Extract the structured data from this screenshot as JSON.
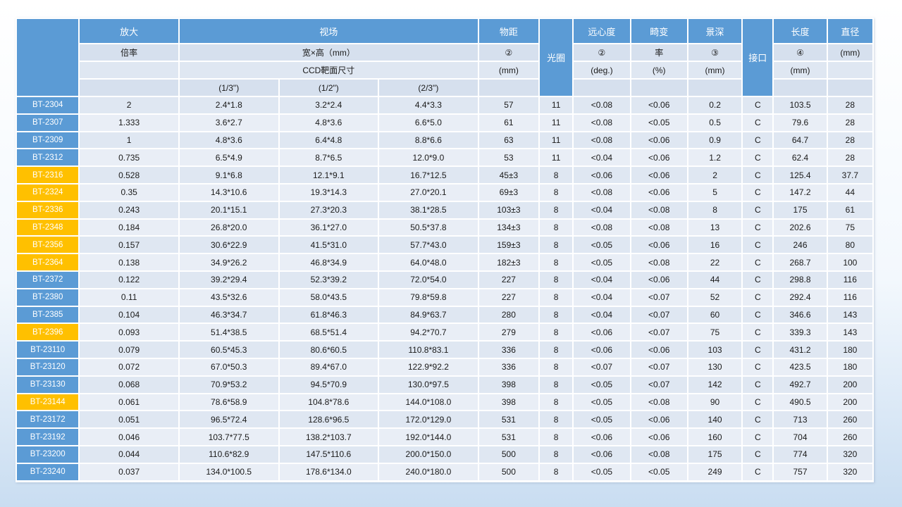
{
  "header": {
    "magnification": "放大",
    "ratio": "倍率",
    "field_of_view": "视场",
    "fov_units": "宽×高（mm）",
    "ccd_target": "CCD靶面尺寸",
    "sensor_1_3": "(1/3\")",
    "sensor_1_2": "(1/2\")",
    "sensor_2_3": "(2/3\")",
    "working_distance": "物距",
    "wd_note": "②",
    "wd_unit": "(mm)",
    "aperture": "光圈",
    "telecentricity": "远心度",
    "tel_note": "②",
    "tel_unit": "(deg.)",
    "distortion": "畸变",
    "distortion_rate": "率",
    "dist_unit": "(%)",
    "dof": "景深",
    "dof_note": "③",
    "dof_unit": "(mm)",
    "mount": "接口",
    "length": "长度",
    "len_note": "④",
    "len_unit": "(mm)",
    "diameter": "直径",
    "dia_unit": "(mm)"
  },
  "rows": [
    {
      "model": "BT-2304",
      "highlight": false,
      "mag": "2",
      "f13": "2.4*1.8",
      "f12": "3.2*2.4",
      "f23": "4.4*3.3",
      "wd": "57",
      "ap": "11",
      "tel": "<0.08",
      "dist": "<0.06",
      "dof": "0.2",
      "mount": "C",
      "len": "103.5",
      "dia": "28"
    },
    {
      "model": "BT-2307",
      "highlight": false,
      "mag": "1.333",
      "f13": "3.6*2.7",
      "f12": "4.8*3.6",
      "f23": "6.6*5.0",
      "wd": "61",
      "ap": "11",
      "tel": "<0.08",
      "dist": "<0.05",
      "dof": "0.5",
      "mount": "C",
      "len": "79.6",
      "dia": "28"
    },
    {
      "model": "BT-2309",
      "highlight": false,
      "mag": "1",
      "f13": "4.8*3.6",
      "f12": "6.4*4.8",
      "f23": "8.8*6.6",
      "wd": "63",
      "ap": "11",
      "tel": "<0.08",
      "dist": "<0.06",
      "dof": "0.9",
      "mount": "C",
      "len": "64.7",
      "dia": "28"
    },
    {
      "model": "BT-2312",
      "highlight": false,
      "mag": "0.735",
      "f13": "6.5*4.9",
      "f12": "8.7*6.5",
      "f23": "12.0*9.0",
      "wd": "53",
      "ap": "11",
      "tel": "<0.04",
      "dist": "<0.06",
      "dof": "1.2",
      "mount": "C",
      "len": "62.4",
      "dia": "28"
    },
    {
      "model": "BT-2316",
      "highlight": true,
      "mag": "0.528",
      "f13": "9.1*6.8",
      "f12": "12.1*9.1",
      "f23": "16.7*12.5",
      "wd": "45±3",
      "ap": "8",
      "tel": "<0.06",
      "dist": "<0.06",
      "dof": "2",
      "mount": "C",
      "len": "125.4",
      "dia": "37.7"
    },
    {
      "model": "BT-2324",
      "highlight": true,
      "mag": "0.35",
      "f13": "14.3*10.6",
      "f12": "19.3*14.3",
      "f23": "27.0*20.1",
      "wd": "69±3",
      "ap": "8",
      "tel": "<0.08",
      "dist": "<0.06",
      "dof": "5",
      "mount": "C",
      "len": "147.2",
      "dia": "44"
    },
    {
      "model": "BT-2336",
      "highlight": true,
      "mag": "0.243",
      "f13": "20.1*15.1",
      "f12": "27.3*20.3",
      "f23": "38.1*28.5",
      "wd": "103±3",
      "ap": "8",
      "tel": "<0.04",
      "dist": "<0.08",
      "dof": "8",
      "mount": "C",
      "len": "175",
      "dia": "61"
    },
    {
      "model": "BT-2348",
      "highlight": true,
      "mag": "0.184",
      "f13": "26.8*20.0",
      "f12": "36.1*27.0",
      "f23": "50.5*37.8",
      "wd": "134±3",
      "ap": "8",
      "tel": "<0.08",
      "dist": "<0.08",
      "dof": "13",
      "mount": "C",
      "len": "202.6",
      "dia": "75"
    },
    {
      "model": "BT-2356",
      "highlight": true,
      "mag": "0.157",
      "f13": "30.6*22.9",
      "f12": "41.5*31.0",
      "f23": "57.7*43.0",
      "wd": "159±3",
      "ap": "8",
      "tel": "<0.05",
      "dist": "<0.06",
      "dof": "16",
      "mount": "C",
      "len": "246",
      "dia": "80"
    },
    {
      "model": "BT-2364",
      "highlight": true,
      "mag": "0.138",
      "f13": "34.9*26.2",
      "f12": "46.8*34.9",
      "f23": "64.0*48.0",
      "wd": "182±3",
      "ap": "8",
      "tel": "<0.05",
      "dist": "<0.08",
      "dof": "22",
      "mount": "C",
      "len": "268.7",
      "dia": "100"
    },
    {
      "model": "BT-2372",
      "highlight": false,
      "mag": "0.122",
      "f13": "39.2*29.4",
      "f12": "52.3*39.2",
      "f23": "72.0*54.0",
      "wd": "227",
      "ap": "8",
      "tel": "<0.04",
      "dist": "<0.06",
      "dof": "44",
      "mount": "C",
      "len": "298.8",
      "dia": "116"
    },
    {
      "model": "BT-2380",
      "highlight": false,
      "mag": "0.11",
      "f13": "43.5*32.6",
      "f12": "58.0*43.5",
      "f23": "79.8*59.8",
      "wd": "227",
      "ap": "8",
      "tel": "<0.04",
      "dist": "<0.07",
      "dof": "52",
      "mount": "C",
      "len": "292.4",
      "dia": "116"
    },
    {
      "model": "BT-2385",
      "highlight": false,
      "mag": "0.104",
      "f13": "46.3*34.7",
      "f12": "61.8*46.3",
      "f23": "84.9*63.7",
      "wd": "280",
      "ap": "8",
      "tel": "<0.04",
      "dist": "<0.07",
      "dof": "60",
      "mount": "C",
      "len": "346.6",
      "dia": "143"
    },
    {
      "model": "BT-2396",
      "highlight": true,
      "mag": "0.093",
      "f13": "51.4*38.5",
      "f12": "68.5*51.4",
      "f23": "94.2*70.7",
      "wd": "279",
      "ap": "8",
      "tel": "<0.06",
      "dist": "<0.07",
      "dof": "75",
      "mount": "C",
      "len": "339.3",
      "dia": "143"
    },
    {
      "model": "BT-23110",
      "highlight": false,
      "mag": "0.079",
      "f13": "60.5*45.3",
      "f12": "80.6*60.5",
      "f23": "110.8*83.1",
      "wd": "336",
      "ap": "8",
      "tel": "<0.06",
      "dist": "<0.06",
      "dof": "103",
      "mount": "C",
      "len": "431.2",
      "dia": "180"
    },
    {
      "model": "BT-23120",
      "highlight": false,
      "mag": "0.072",
      "f13": "67.0*50.3",
      "f12": "89.4*67.0",
      "f23": "122.9*92.2",
      "wd": "336",
      "ap": "8",
      "tel": "<0.07",
      "dist": "<0.07",
      "dof": "130",
      "mount": "C",
      "len": "423.5",
      "dia": "180"
    },
    {
      "model": "BT-23130",
      "highlight": false,
      "mag": "0.068",
      "f13": "70.9*53.2",
      "f12": "94.5*70.9",
      "f23": "130.0*97.5",
      "wd": "398",
      "ap": "8",
      "tel": "<0.05",
      "dist": "<0.07",
      "dof": "142",
      "mount": "C",
      "len": "492.7",
      "dia": "200"
    },
    {
      "model": "BT-23144",
      "highlight": true,
      "mag": "0.061",
      "f13": "78.6*58.9",
      "f12": "104.8*78.6",
      "f23": "144.0*108.0",
      "wd": "398",
      "ap": "8",
      "tel": "<0.05",
      "dist": "<0.08",
      "dof": "90",
      "mount": "C",
      "len": "490.5",
      "dia": "200"
    },
    {
      "model": "BT-23172",
      "highlight": false,
      "mag": "0.051",
      "f13": "96.5*72.4",
      "f12": "128.6*96.5",
      "f23": "172.0*129.0",
      "wd": "531",
      "ap": "8",
      "tel": "<0.05",
      "dist": "<0.06",
      "dof": "140",
      "mount": "C",
      "len": "713",
      "dia": "260"
    },
    {
      "model": "BT-23192",
      "highlight": false,
      "mag": "0.046",
      "f13": "103.7*77.5",
      "f12": "138.2*103.7",
      "f23": "192.0*144.0",
      "wd": "531",
      "ap": "8",
      "tel": "<0.06",
      "dist": "<0.06",
      "dof": "160",
      "mount": "C",
      "len": "704",
      "dia": "260"
    },
    {
      "model": "BT-23200",
      "highlight": false,
      "mag": "0.044",
      "f13": "110.6*82.9",
      "f12": "147.5*110.6",
      "f23": "200.0*150.0",
      "wd": "500",
      "ap": "8",
      "tel": "<0.06",
      "dist": "<0.08",
      "dof": "175",
      "mount": "C",
      "len": "774",
      "dia": "320"
    },
    {
      "model": "BT-23240",
      "highlight": false,
      "mag": "0.037",
      "f13": "134.0*100.5",
      "f12": "178.6*134.0",
      "f23": "240.0*180.0",
      "wd": "500",
      "ap": "8",
      "tel": "<0.05",
      "dist": "<0.05",
      "dof": "249",
      "mount": "C",
      "len": "757",
      "dia": "320"
    }
  ]
}
